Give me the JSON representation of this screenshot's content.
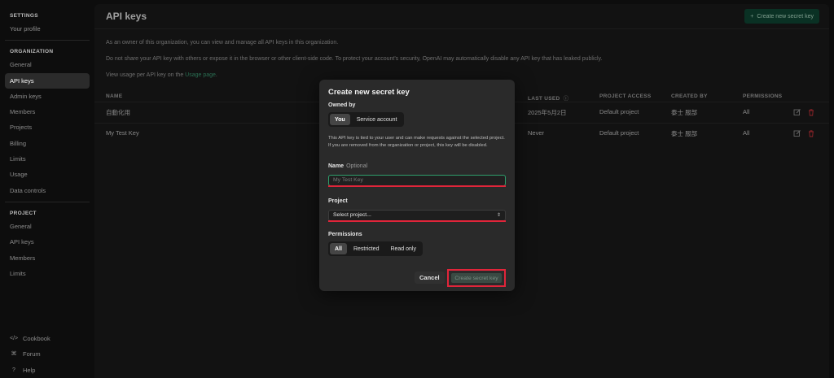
{
  "sidebar": {
    "settings_header": "SETTINGS",
    "your_profile": "Your profile",
    "organization_header": "ORGANIZATION",
    "org_items": [
      "General",
      "API keys",
      "Admin keys",
      "Members",
      "Projects",
      "Billing",
      "Limits",
      "Usage",
      "Data controls"
    ],
    "project_header": "PROJECT",
    "project_items": [
      "General",
      "API keys",
      "Members",
      "Limits"
    ],
    "bottom_items": [
      {
        "glyph": "</>",
        "label": "Cookbook"
      },
      {
        "glyph": "⌘",
        "label": "Forum"
      },
      {
        "glyph": "?",
        "label": "Help"
      }
    ]
  },
  "header": {
    "title": "API keys",
    "create_button": "Create new secret key"
  },
  "intro": {
    "line1": "As an owner of this organization, you can view and manage all API keys in this organization.",
    "line2": "Do not share your API key with others or expose it in the browser or other client-side code. To protect your account's security, OpenAI may automatically disable any API key that has leaked publicly.",
    "line3_prefix": "View usage per API key on the ",
    "line3_link": "Usage page",
    "line3_suffix": "."
  },
  "table": {
    "columns": [
      "NAME",
      "LAST USED",
      "PROJECT ACCESS",
      "CREATED BY",
      "PERMISSIONS"
    ],
    "rows": [
      {
        "name": "自動化用",
        "last_used": "2025年5月2日",
        "project": "Default project",
        "created_by": "泰士 服部",
        "permissions": "All"
      },
      {
        "name": "My Test Key",
        "last_used": "Never",
        "project": "Default project",
        "created_by": "泰士 服部",
        "permissions": "All"
      }
    ]
  },
  "modal": {
    "title": "Create new secret key",
    "owned_by_label": "Owned by",
    "owner_options": [
      "You",
      "Service account"
    ],
    "help_text": "This API key is tied to your user and can make requests against the selected project. If you are removed from the organization or project, this key will be disabled.",
    "name_label": "Name",
    "name_optional": "Optional",
    "name_placeholder": "My Test Key",
    "project_label": "Project",
    "project_value": "Select project...",
    "permissions_label": "Permissions",
    "permission_options": [
      "All",
      "Restricted",
      "Read only"
    ],
    "cancel": "Cancel",
    "submit": "Create secret key"
  },
  "colors": {
    "accent_green": "#2e9e6b",
    "annotation_red": "#e0253a"
  }
}
